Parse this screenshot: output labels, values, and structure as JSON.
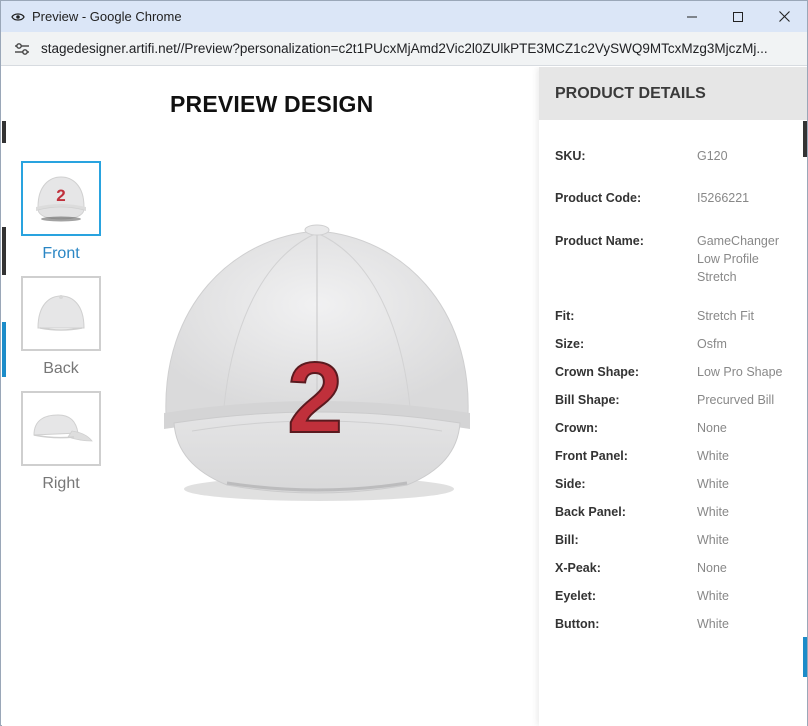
{
  "window": {
    "title": "Preview - Google Chrome",
    "url": "stagedesigner.artifi.net//Preview?personalization=c2t1PUcxMjAmd2Vic2l0ZUlkPTE3MCZ1c2VySWQ9MTcxMzg3MjczMj..."
  },
  "preview": {
    "title": "PREVIEW DESIGN",
    "cap_number": "2",
    "views": [
      {
        "label": "Front"
      },
      {
        "label": "Back"
      },
      {
        "label": "Right"
      }
    ]
  },
  "details": {
    "header": "PRODUCT DETAILS",
    "rows": [
      {
        "label": "SKU:",
        "value": "G120"
      },
      {
        "label": "Product Code:",
        "value": "I5266221"
      },
      {
        "label": "Product Name:",
        "value": "GameChanger Low Profile Stretch"
      },
      {
        "label": "Fit:",
        "value": "Stretch Fit"
      },
      {
        "label": "Size:",
        "value": "Osfm"
      },
      {
        "label": "Crown Shape:",
        "value": "Low Pro Shape"
      },
      {
        "label": "Bill Shape:",
        "value": "Precurved Bill"
      },
      {
        "label": "Crown:",
        "value": "None"
      },
      {
        "label": "Front Panel:",
        "value": "White"
      },
      {
        "label": "Side:",
        "value": "White"
      },
      {
        "label": "Back Panel:",
        "value": "White"
      },
      {
        "label": "Bill:",
        "value": "White"
      },
      {
        "label": "X-Peak:",
        "value": "None"
      },
      {
        "label": "Eyelet:",
        "value": "White"
      },
      {
        "label": "Button:",
        "value": "White"
      }
    ]
  },
  "colors": {
    "accent": "#29a3df",
    "number": "#c0303b",
    "cap": "#e9e9ea"
  }
}
